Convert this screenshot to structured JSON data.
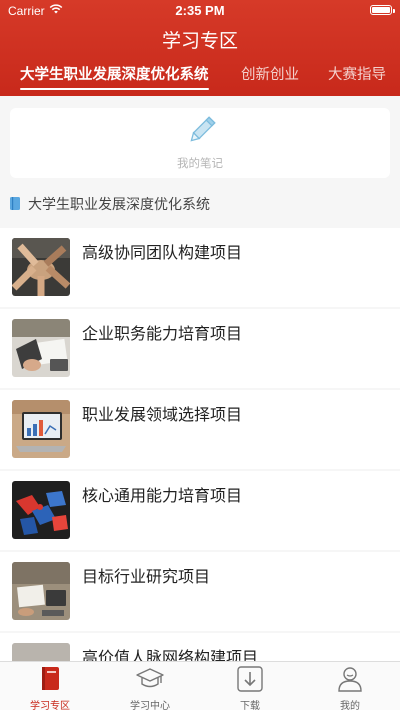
{
  "status_bar": {
    "carrier": "Carrier",
    "time": "2:35 PM"
  },
  "header": {
    "title": "学习专区"
  },
  "tabs": [
    {
      "label": "大学生职业发展深度优化系统",
      "active": true
    },
    {
      "label": "创新创业",
      "active": false
    },
    {
      "label": "大赛指导",
      "active": false
    }
  ],
  "notes": {
    "label": "我的笔记",
    "icon": "pencil-icon"
  },
  "section": {
    "title": "大学生职业发展深度优化系统",
    "icon": "book-icon"
  },
  "items": [
    {
      "title": "高级协同团队构建项目"
    },
    {
      "title": "企业职务能力培育项目"
    },
    {
      "title": "职业发展领域选择项目"
    },
    {
      "title": "核心通用能力培育项目"
    },
    {
      "title": "目标行业研究项目"
    },
    {
      "title": "高价值人脉网络构建项目"
    }
  ],
  "tabbar": [
    {
      "label": "学习专区",
      "icon": "book-icon",
      "active": true
    },
    {
      "label": "学习中心",
      "icon": "graduation-cap-icon",
      "active": false
    },
    {
      "label": "下载",
      "icon": "download-icon",
      "active": false
    },
    {
      "label": "我的",
      "icon": "user-icon",
      "active": false
    }
  ],
  "colors": {
    "accent": "#c8291b",
    "header_bg": "#d63a28"
  }
}
